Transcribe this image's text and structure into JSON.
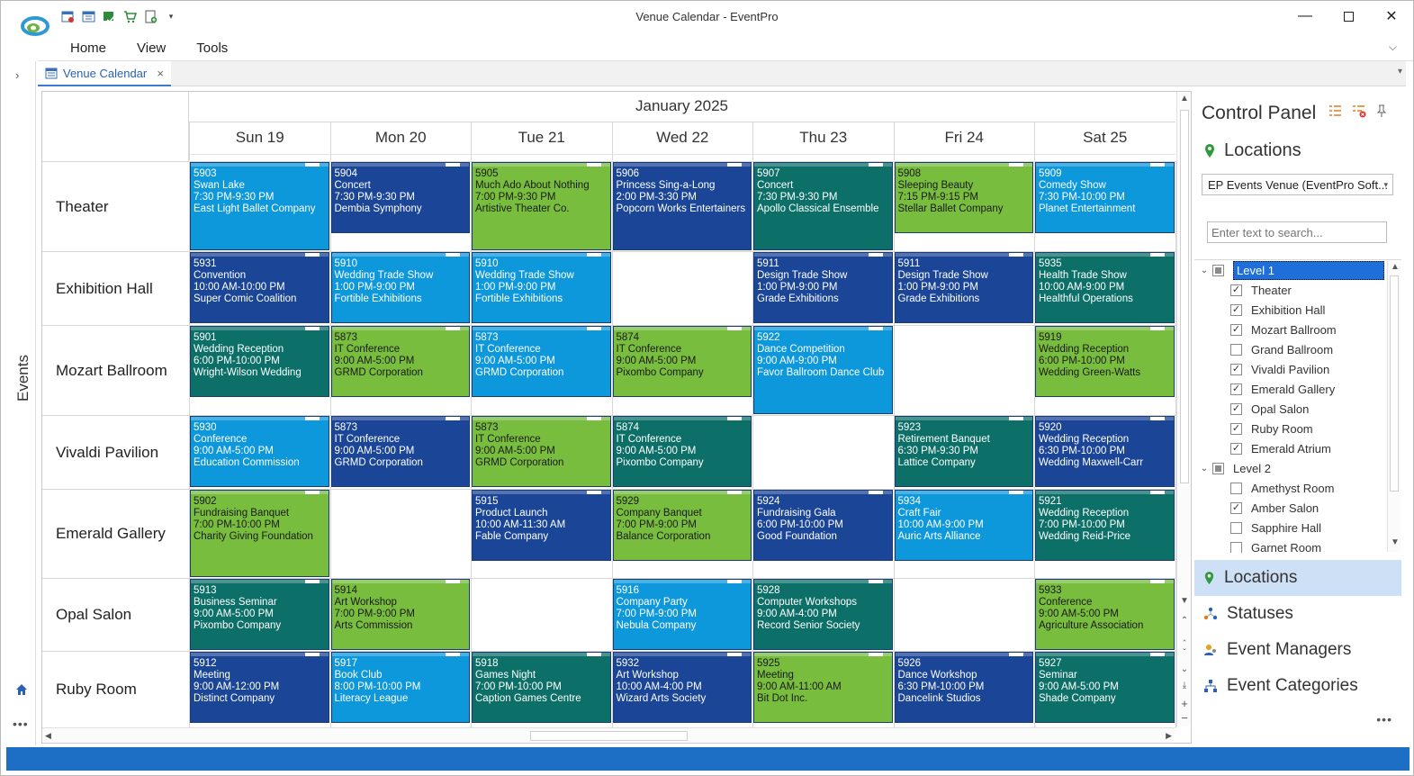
{
  "window": {
    "title": "Venue Calendar - EventPro"
  },
  "menu": [
    "Home",
    "View",
    "Tools"
  ],
  "tab": {
    "label": "Venue Calendar",
    "close": "×"
  },
  "left_strip": {
    "label": "Events"
  },
  "calendar": {
    "month": "January 2025",
    "days": [
      "Sun 19",
      "Mon 20",
      "Tue 21",
      "Wed 22",
      "Thu 23",
      "Fri 24",
      "Sat 25"
    ],
    "resources": [
      "Theater",
      "Exhibition Hall",
      "Mozart Ballroom",
      "Vivaldi Pavilion",
      "Emerald Gallery",
      "Opal Salon",
      "Ruby Room"
    ],
    "colors": {
      "light": "#0e98dc",
      "dark": "#1b4596",
      "teal": "#0c7068",
      "green": "#79bd3f"
    },
    "events": [
      {
        "row": 0,
        "col": 0,
        "color": "light",
        "tall": true,
        "id": "5903",
        "name": "Swan Lake",
        "time": "7:30 PM-9:30 PM",
        "org": "East Light Ballet Company"
      },
      {
        "row": 0,
        "col": 1,
        "color": "dark",
        "id": "5904",
        "name": "Concert",
        "time": "7:30 PM-9:30 PM",
        "org": "Dembia Symphony"
      },
      {
        "row": 0,
        "col": 2,
        "color": "green",
        "tall": true,
        "id": "5905",
        "name": "Much Ado About Nothing",
        "time": "7:00 PM-9:30 PM",
        "org": "Artistive Theater Co."
      },
      {
        "row": 0,
        "col": 3,
        "color": "dark",
        "tall": true,
        "id": "5906",
        "name": "Princess Sing-a-Long",
        "time": "2:00 PM-3:30 PM",
        "org": "Popcorn Works Entertainers"
      },
      {
        "row": 0,
        "col": 4,
        "color": "teal",
        "tall": true,
        "id": "5907",
        "name": "Concert",
        "time": "7:30 PM-9:30 PM",
        "org": "Apollo Classical Ensemble"
      },
      {
        "row": 0,
        "col": 5,
        "color": "green",
        "id": "5908",
        "name": "Sleeping Beauty",
        "time": "7:15 PM-9:15 PM",
        "org": "Stellar Ballet Company"
      },
      {
        "row": 0,
        "col": 6,
        "color": "light",
        "id": "5909",
        "name": "Comedy Show",
        "time": "7:30 PM-10:00 PM",
        "org": "Planet Entertainment"
      },
      {
        "row": 1,
        "col": 0,
        "color": "dark",
        "id": "5931",
        "name": "Convention",
        "time": "10:00 AM-10:00 PM",
        "org": "Super Comic Coalition"
      },
      {
        "row": 1,
        "col": 1,
        "color": "light",
        "id": "5910",
        "name": "Wedding Trade Show",
        "time": "1:00 PM-9:00 PM",
        "org": "Fortible Exhibitions"
      },
      {
        "row": 1,
        "col": 2,
        "color": "light",
        "id": "5910",
        "name": "Wedding Trade Show",
        "time": "1:00 PM-9:00 PM",
        "org": "Fortible Exhibitions"
      },
      {
        "row": 1,
        "col": 4,
        "color": "dark",
        "id": "5911",
        "name": "Design Trade Show",
        "time": "1:00 PM-9:00 PM",
        "org": "Grade Exhibitions"
      },
      {
        "row": 1,
        "col": 5,
        "color": "dark",
        "id": "5911",
        "name": "Design Trade Show",
        "time": "1:00 PM-9:00 PM",
        "org": "Grade Exhibitions"
      },
      {
        "row": 1,
        "col": 6,
        "color": "teal",
        "id": "5935",
        "name": "Health Trade Show",
        "time": "10:00 AM-9:00 PM",
        "org": "Healthful Operations"
      },
      {
        "row": 2,
        "col": 0,
        "color": "teal",
        "id": "5901",
        "name": "Wedding Reception",
        "time": "6:00 PM-10:00 PM",
        "org": "Wright-Wilson Wedding"
      },
      {
        "row": 2,
        "col": 1,
        "color": "green",
        "id": "5873",
        "name": "IT Conference",
        "time": "9:00 AM-5:00 PM",
        "org": "GRMD Corporation"
      },
      {
        "row": 2,
        "col": 2,
        "color": "light",
        "id": "5873",
        "name": "IT Conference",
        "time": "9:00 AM-5:00 PM",
        "org": "GRMD Corporation"
      },
      {
        "row": 2,
        "col": 3,
        "color": "green",
        "id": "5874",
        "name": "IT Conference",
        "time": "9:00 AM-5:00 PM",
        "org": "Pixombo Company"
      },
      {
        "row": 2,
        "col": 4,
        "color": "light",
        "tall": true,
        "id": "5922",
        "name": "Dance Competition",
        "time": "9:00 AM-9:00 PM",
        "org": "Favor Ballroom Dance Club"
      },
      {
        "row": 2,
        "col": 6,
        "color": "green",
        "id": "5919",
        "name": "Wedding Reception",
        "time": "6:00 PM-10:00 PM",
        "org": "Wedding Green-Watts"
      },
      {
        "row": 3,
        "col": 0,
        "color": "light",
        "id": "5930",
        "name": "Conference",
        "time": "9:00 AM-5:00 PM",
        "org": "Education Commission"
      },
      {
        "row": 3,
        "col": 1,
        "color": "dark",
        "id": "5873",
        "name": "IT Conference",
        "time": "9:00 AM-5:00 PM",
        "org": "GRMD Corporation"
      },
      {
        "row": 3,
        "col": 2,
        "color": "green",
        "id": "5873",
        "name": "IT Conference",
        "time": "9:00 AM-5:00 PM",
        "org": "GRMD Corporation"
      },
      {
        "row": 3,
        "col": 3,
        "color": "teal",
        "id": "5874",
        "name": "IT Conference",
        "time": "9:00 AM-5:00 PM",
        "org": "Pixombo Company"
      },
      {
        "row": 3,
        "col": 5,
        "color": "teal",
        "id": "5923",
        "name": "Retirement Banquet",
        "time": "6:30 PM-9:30 PM",
        "org": "Lattice Company"
      },
      {
        "row": 3,
        "col": 6,
        "color": "dark",
        "id": "5920",
        "name": "Wedding Reception",
        "time": "6:30 PM-10:00 PM",
        "org": "Wedding Maxwell-Carr"
      },
      {
        "row": 4,
        "col": 0,
        "color": "green",
        "tall": true,
        "id": "5902",
        "name": "Fundraising Banquet",
        "time": "7:00 PM-10:00 PM",
        "org": "Charity Giving Foundation"
      },
      {
        "row": 4,
        "col": 2,
        "color": "dark",
        "id": "5915",
        "name": "Product Launch",
        "time": "10:00 AM-11:30 AM",
        "org": "Fable Company"
      },
      {
        "row": 4,
        "col": 3,
        "color": "green",
        "id": "5929",
        "name": "Company Banquet",
        "time": "7:00 PM-9:00 PM",
        "org": "Balance Corporation"
      },
      {
        "row": 4,
        "col": 4,
        "color": "dark",
        "id": "5924",
        "name": "Fundraising Gala",
        "time": "6:00 PM-10:00 PM",
        "org": "Good Foundation"
      },
      {
        "row": 4,
        "col": 5,
        "color": "light",
        "id": "5934",
        "name": "Craft Fair",
        "time": "10:00 AM-9:00 PM",
        "org": "Auric Arts Alliance"
      },
      {
        "row": 4,
        "col": 6,
        "color": "teal",
        "id": "5921",
        "name": "Wedding Reception",
        "time": "7:00 PM-10:00 PM",
        "org": "Wedding Reid-Price"
      },
      {
        "row": 5,
        "col": 0,
        "color": "teal",
        "id": "5913",
        "name": "Business Seminar",
        "time": "9:00 AM-5:00 PM",
        "org": "Pixombo Company"
      },
      {
        "row": 5,
        "col": 1,
        "color": "green",
        "id": "5914",
        "name": "Art Workshop",
        "time": "7:00 PM-9:00 PM",
        "org": "Arts Commission"
      },
      {
        "row": 5,
        "col": 3,
        "color": "light",
        "id": "5916",
        "name": "Company Party",
        "time": "7:00 PM-9:00 PM",
        "org": "Nebula Company"
      },
      {
        "row": 5,
        "col": 4,
        "color": "teal",
        "id": "5928",
        "name": "Computer Workshops",
        "time": "9:00 AM-4:00 PM",
        "org": "Record Senior Society"
      },
      {
        "row": 5,
        "col": 6,
        "color": "green",
        "id": "5933",
        "name": "Conference",
        "time": "9:00 AM-5:00 PM",
        "org": "Agriculture Association"
      },
      {
        "row": 6,
        "col": 0,
        "color": "dark",
        "id": "5912",
        "name": "Meeting",
        "time": "9:00 AM-12:00 PM",
        "org": "Distinct Company"
      },
      {
        "row": 6,
        "col": 1,
        "color": "light",
        "id": "5917",
        "name": "Book Club",
        "time": "8:00 PM-10:00 PM",
        "org": "Literacy League"
      },
      {
        "row": 6,
        "col": 2,
        "color": "teal",
        "id": "5918",
        "name": "Games Night",
        "time": "7:00 PM-10:00 PM",
        "org": "Caption Games Centre"
      },
      {
        "row": 6,
        "col": 3,
        "color": "dark",
        "id": "5932",
        "name": "Art Workshop",
        "time": "10:00 AM-4:00 PM",
        "org": "Wizard Arts Society"
      },
      {
        "row": 6,
        "col": 4,
        "color": "green",
        "id": "5925",
        "name": "Meeting",
        "time": "9:00 AM-11:00 AM",
        "org": "Bit Dot Inc."
      },
      {
        "row": 6,
        "col": 5,
        "color": "dark",
        "id": "5926",
        "name": "Dance Workshop",
        "time": "6:30 PM-10:00 PM",
        "org": "Dancelink Studios"
      },
      {
        "row": 6,
        "col": 6,
        "color": "teal",
        "id": "5927",
        "name": "Seminar",
        "time": "9:00 AM-5:00 PM",
        "org": "Shade Company"
      }
    ]
  },
  "control_panel": {
    "title": "Control Panel",
    "locations_heading": "Locations",
    "venue_select": "EP Events Venue (EventPro Soft...",
    "search_placeholder": "Enter text to search...",
    "tree": [
      {
        "type": "level",
        "label": "Level 1",
        "selected": true
      },
      {
        "type": "item",
        "label": "Theater",
        "checked": true
      },
      {
        "type": "item",
        "label": "Exhibition Hall",
        "checked": true
      },
      {
        "type": "item",
        "label": "Mozart Ballroom",
        "checked": true
      },
      {
        "type": "item",
        "label": "Grand Ballroom",
        "checked": false
      },
      {
        "type": "item",
        "label": "Vivaldi Pavilion",
        "checked": true
      },
      {
        "type": "item",
        "label": "Emerald Gallery",
        "checked": true
      },
      {
        "type": "item",
        "label": "Opal Salon",
        "checked": true
      },
      {
        "type": "item",
        "label": "Ruby Room",
        "checked": true
      },
      {
        "type": "item",
        "label": "Emerald Atrium",
        "checked": true
      },
      {
        "type": "level",
        "label": "Level 2",
        "selected": false
      },
      {
        "type": "item",
        "label": "Amethyst Room",
        "checked": false
      },
      {
        "type": "item",
        "label": "Amber Salon",
        "checked": true
      },
      {
        "type": "item",
        "label": "Sapphire Hall",
        "checked": false
      },
      {
        "type": "item",
        "label": "Garnet Room",
        "checked": false
      }
    ],
    "accordion": [
      {
        "label": "Locations",
        "icon": "location-pin-icon",
        "active": true
      },
      {
        "label": "Statuses",
        "icon": "statuses-icon",
        "active": false
      },
      {
        "label": "Event Managers",
        "icon": "event-managers-icon",
        "active": false
      },
      {
        "label": "Event Categories",
        "icon": "event-categories-icon",
        "active": false
      }
    ]
  }
}
